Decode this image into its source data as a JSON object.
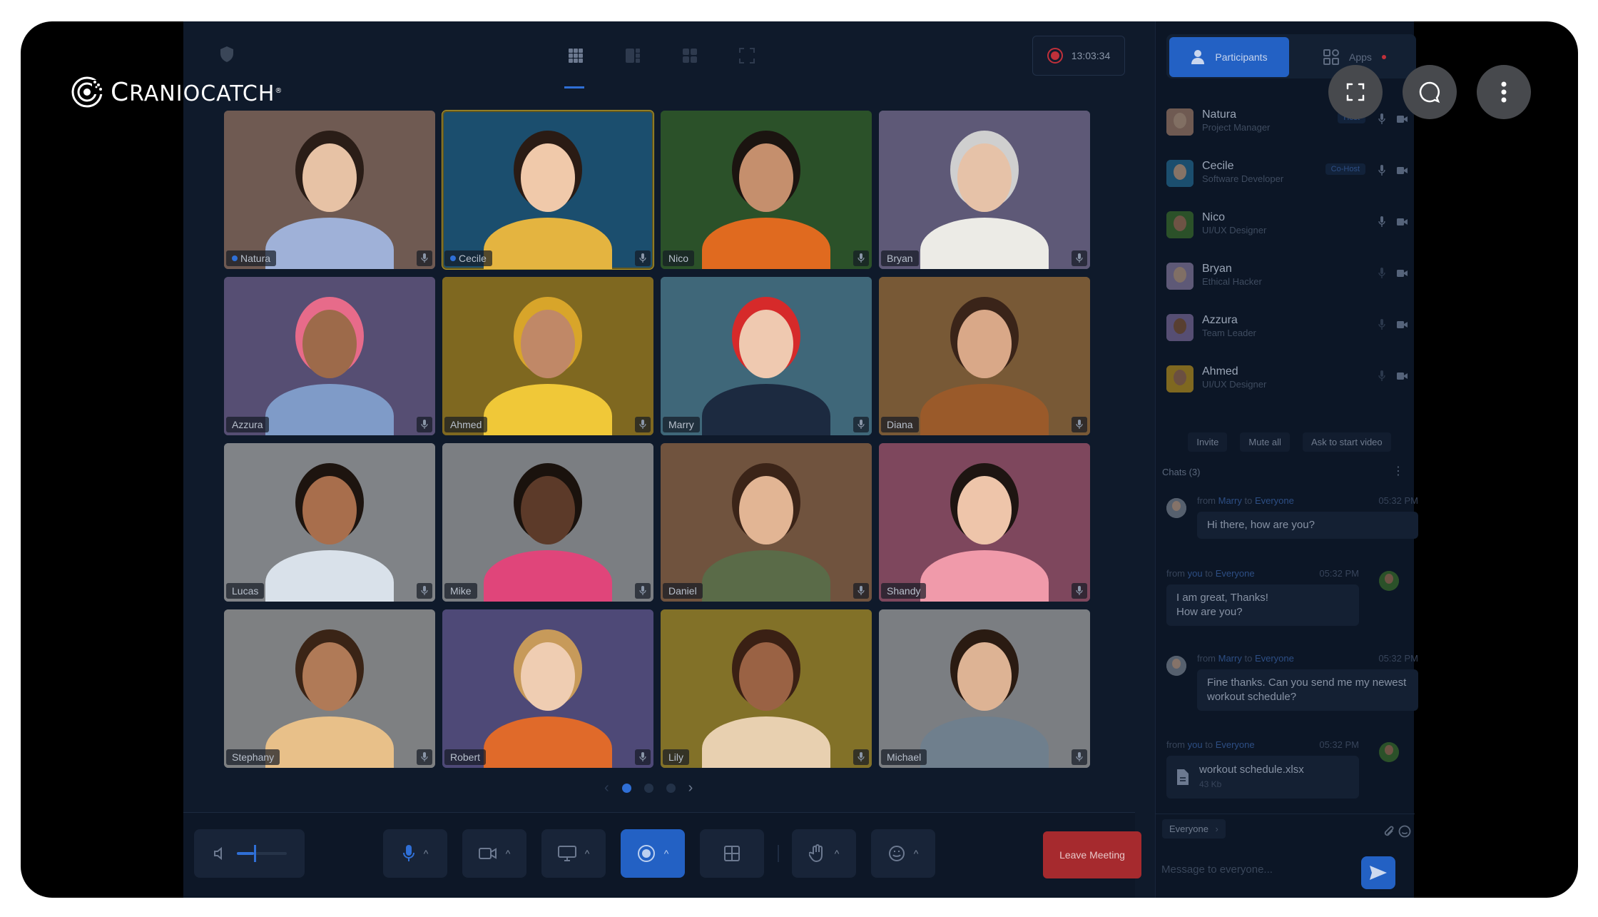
{
  "brand": {
    "logo_text": "CRANIOCATCH",
    "logo_first_letter": "C",
    "logo_rest": "RANIOCATCH"
  },
  "timer": "13:03:34",
  "tabs": {
    "participants": "Participants",
    "apps": "Apps"
  },
  "tiles": [
    {
      "name": "Natura",
      "bg": "#c79b86",
      "skin": "#e7c2a5",
      "hair": "#2a1d17",
      "shirt": "#9fb1d8",
      "dot": true
    },
    {
      "name": "Cecile",
      "bg": "#2e86b8",
      "skin": "#f0c9aa",
      "hair": "#2a1b14",
      "shirt": "#e4b440",
      "dot": true,
      "active": true
    },
    {
      "name": "Nico",
      "bg": "#4c8a3b",
      "skin": "#c58f6d",
      "hair": "#1b1410",
      "shirt": "#e06a1f"
    },
    {
      "name": "Bryan",
      "bg": "#a89ac8",
      "skin": "#e6c2a8",
      "hair": "#cfcfcf",
      "shirt": "#ecebe6"
    },
    {
      "name": "Azzura",
      "bg": "#9a86c2",
      "skin": "#9d6a4a",
      "hair": "#e76b8a",
      "shirt": "#7f9bc8"
    },
    {
      "name": "Ahmed",
      "bg": "#e4b52a",
      "skin": "#c08867",
      "hair": "#d8a52a",
      "shirt": "#f0c838"
    },
    {
      "name": "Marry",
      "bg": "#6fb2cc",
      "skin": "#efc9b0",
      "hair": "#d62a2a",
      "shirt": "#1c2a40"
    },
    {
      "name": "Diana",
      "bg": "#d89a52",
      "skin": "#d9a888",
      "hair": "#3a2419",
      "shirt": "#9a5a2a"
    },
    {
      "name": "Lucas",
      "bg": "#e5e5e5",
      "skin": "#a86e4c",
      "hair": "#1d140f",
      "shirt": "#d9e1ea"
    },
    {
      "name": "Mike",
      "bg": "#dcdcdc",
      "skin": "#5c3a29",
      "hair": "#1a120d",
      "shirt": "#e0457a"
    },
    {
      "name": "Daniel",
      "bg": "#c98f62",
      "skin": "#e2b594",
      "hair": "#3b2418",
      "shirt": "#5a6b48"
    },
    {
      "name": "Shandy",
      "bg": "#e2789a",
      "skin": "#eec5aa",
      "hair": "#1e1512",
      "shirt": "#f09aaa"
    },
    {
      "name": "Stephany",
      "bg": "#e2e0dc",
      "skin": "#b07a57",
      "hair": "#3a2416",
      "shirt": "#e8c089"
    },
    {
      "name": "Robert",
      "bg": "#8a7cc8",
      "skin": "#efcdb2",
      "hair": "#c79a5a",
      "shirt": "#e06a2a"
    },
    {
      "name": "Lily",
      "bg": "#e9c53a",
      "skin": "#9a6244",
      "hair": "#3a2014",
      "shirt": "#e8d0b0"
    },
    {
      "name": "Michael",
      "bg": "#dddddd",
      "skin": "#ddb394",
      "hair": "#2a1b12",
      "shirt": "#6f7f8d"
    }
  ],
  "pager": {
    "pages": 3,
    "current": 1
  },
  "controls": {
    "leave": "Leave Meeting",
    "volume_level": 0.35
  },
  "participants": [
    {
      "name": "Natura",
      "role": "Project Manager",
      "badge": "Host",
      "color": "#e7c2a5",
      "bg": "#c79b86"
    },
    {
      "name": "Cecile",
      "role": "Software Developer",
      "badge": "Co-Host",
      "color": "#f0c9aa",
      "bg": "#2e86b8"
    },
    {
      "name": "Nico",
      "role": "UI/UX Designer",
      "badge": "",
      "color": "#c58f6d",
      "bg": "#4c8a3b"
    },
    {
      "name": "Bryan",
      "role": "Ethical Hacker",
      "badge": "",
      "color": "#e6c2a8",
      "bg": "#a89ac8"
    },
    {
      "name": "Azzura",
      "role": "Team Leader",
      "badge": "",
      "color": "#9d6a4a",
      "bg": "#9a86c2"
    },
    {
      "name": "Ahmed",
      "role": "UI/UX Designer",
      "badge": "",
      "color": "#c08867",
      "bg": "#e4b52a"
    }
  ],
  "participant_actions": [
    "Invite",
    "Mute all",
    "Ask to start video"
  ],
  "chats": {
    "heading": "Chats (3)",
    "messages": [
      {
        "from": "Marry",
        "to": "Everyone",
        "time": "05:32 PM",
        "text": "Hi there, how are you?",
        "incoming": true
      },
      {
        "from": "you",
        "to": "Everyone",
        "time": "05:32 PM",
        "text": "I am great, Thanks!\nHow are you?",
        "incoming": false
      },
      {
        "from": "Marry",
        "to": "Everyone",
        "time": "05:32 PM",
        "text": "Fine thanks. Can you send me my newest workout schedule?",
        "incoming": true
      },
      {
        "from": "you",
        "to": "Everyone",
        "time": "05:32 PM",
        "file_name": "workout schedule.xlsx",
        "file_size": "43 Kb",
        "incoming": false
      }
    ],
    "word_from": "from",
    "word_to": "to"
  },
  "composer": {
    "recipient": "Everyone",
    "placeholder": "Message to everyone..."
  }
}
